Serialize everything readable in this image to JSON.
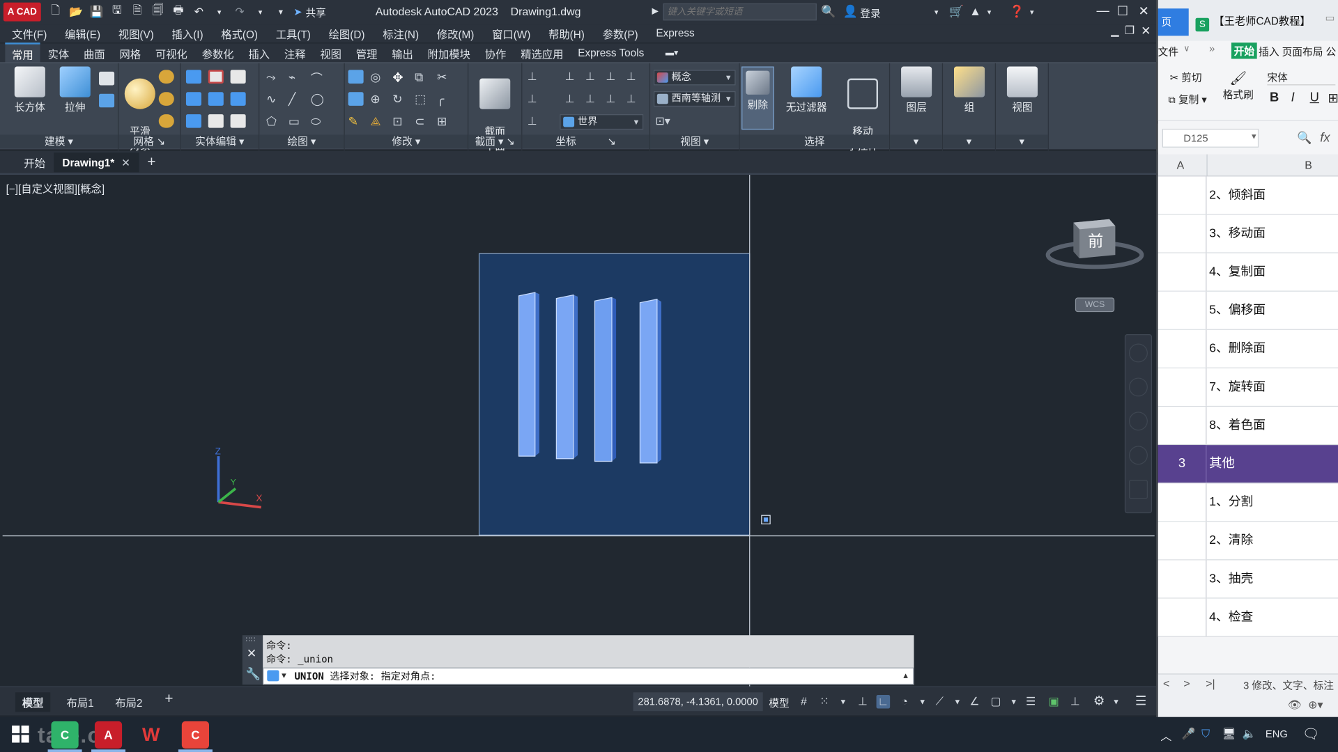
{
  "titlebar": {
    "logo": "A CAD",
    "share": "共享",
    "app_title": "Autodesk AutoCAD 2023",
    "file_name": "Drawing1.dwg",
    "search_placeholder": "键入关键字或短语",
    "login": "登录"
  },
  "menubar": [
    "文件(F)",
    "编辑(E)",
    "视图(V)",
    "插入(I)",
    "格式(O)",
    "工具(T)",
    "绘图(D)",
    "标注(N)",
    "修改(M)",
    "窗口(W)",
    "帮助(H)",
    "参数(P)",
    "Express"
  ],
  "ribbon_tabs": [
    "常用",
    "实体",
    "曲面",
    "网格",
    "可视化",
    "参数化",
    "插入",
    "注释",
    "视图",
    "管理",
    "输出",
    "附加模块",
    "协作",
    "精选应用",
    "Express Tools"
  ],
  "ribbon": {
    "box": "长方体",
    "extrude": "拉伸",
    "smooth": "平滑\n对象",
    "section_plane": "截面\n平面",
    "visual_style": "概念",
    "view_direction": "西南等轴测",
    "ucs": "世界",
    "cull": "剔除",
    "no_filter": "无过滤器",
    "move_gizmo": "移动\n小控件",
    "layers": "图层",
    "groups": "组",
    "view": "视图",
    "panels": {
      "modeling": "建模",
      "mesh": "网格",
      "solid_edit": "实体编辑",
      "draw": "绘图",
      "modify": "修改",
      "section": "截面",
      "coordinates": "坐标",
      "view": "视图",
      "selection": "选择"
    }
  },
  "file_tabs": {
    "start": "开始",
    "drawing": "Drawing1*"
  },
  "viewport": {
    "label": "[−][自定义视图][概念]",
    "viewcube_face": "前",
    "wcs": "WCS"
  },
  "command": {
    "history": [
      "命令:",
      "命令: _union"
    ],
    "keyword": "UNION",
    "prompt": "选择对象: 指定对角点:"
  },
  "layout_tabs": [
    "模型",
    "布局1",
    "布局2"
  ],
  "status": {
    "coords": "281.6878, -4.1361, 0.0000",
    "space": "模型"
  },
  "spreadsheet": {
    "tab_home": "页",
    "doc_title": "【王老师CAD教程】",
    "menu_file": "文件",
    "menu_start": "开始",
    "menu_rest": "插入 页面布局 公",
    "cut": "剪切",
    "copy": "复制",
    "format_painter": "格式刷",
    "font": "宋体",
    "cell_ref": "D125",
    "fx": "fx",
    "col_a": "A",
    "col_b": "B",
    "rows": [
      {
        "num": "",
        "text": "2、倾斜面"
      },
      {
        "num": "",
        "text": "3、移动面"
      },
      {
        "num": "",
        "text": "4、复制面"
      },
      {
        "num": "",
        "text": "5、偏移面"
      },
      {
        "num": "",
        "text": "6、删除面"
      },
      {
        "num": "",
        "text": "7、旋转面"
      },
      {
        "num": "",
        "text": "8、着色面"
      },
      {
        "num": "3",
        "text": "其他",
        "highlight": true
      },
      {
        "num": "",
        "text": "1、分割"
      },
      {
        "num": "",
        "text": "2、清除"
      },
      {
        "num": "",
        "text": "3、抽壳"
      },
      {
        "num": "",
        "text": "4、检查"
      }
    ],
    "sheet_tab": "3 修改、文字、标注"
  },
  "taskbar": {
    "watermark": "tafe.cc",
    "lang": "ENG"
  },
  "colors": {
    "accent": "#3e8fd6",
    "viewport_bg": "#212830",
    "solid_face": "#6f9ef0",
    "highlight_row": "#58418f"
  }
}
